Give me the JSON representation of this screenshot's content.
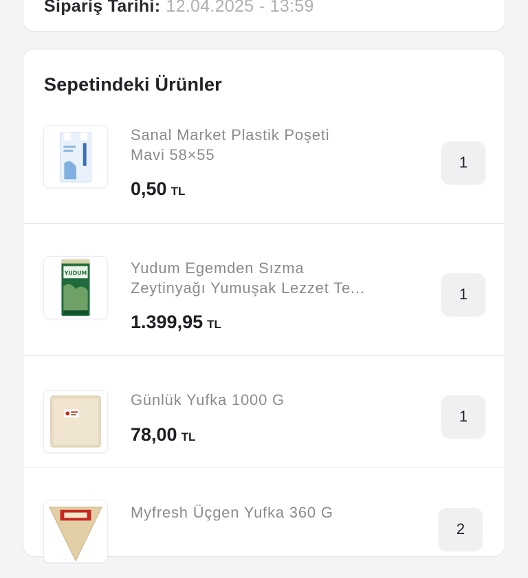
{
  "order": {
    "date_label": "Sipariş Tarihi:",
    "date_value": "12.04.2025 - 13:59"
  },
  "basket": {
    "title": "Sepetindeki Ürünler",
    "items": [
      {
        "name_line1": "Sanal Market Plastik Poşeti",
        "name_line2": "Mavi 58×55",
        "price": "0,50",
        "currency": "TL",
        "quantity": "1",
        "image_icon": "plastic-bag-icon"
      },
      {
        "name_line1": "Yudum Egemden Sızma",
        "name_line2": "Zeytinyağı Yumuşak Lezzet Te...",
        "price": "1.399,95",
        "currency": "TL",
        "quantity": "1",
        "image_icon": "olive-oil-tin-icon"
      },
      {
        "name_line1": "Günlük Yufka 1000 G",
        "name_line2": "",
        "price": "78,00",
        "currency": "TL",
        "quantity": "1",
        "image_icon": "yufka-pack-icon"
      },
      {
        "name_line1": "Myfresh Üçgen Yufka 360 G",
        "name_line2": "",
        "price": "",
        "currency": "",
        "quantity": "2",
        "image_icon": "triangle-yufka-icon"
      }
    ]
  }
}
